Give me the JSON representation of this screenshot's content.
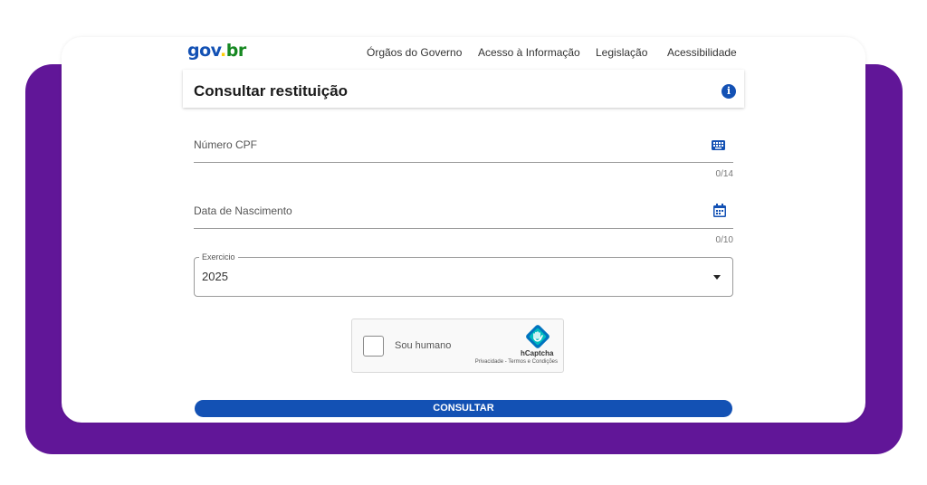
{
  "logo": {
    "part1": "gov",
    "dot": ".",
    "part2": "br"
  },
  "nav": {
    "items": [
      "Órgãos do Governo",
      "Acesso à Informação",
      "Legislação",
      "Acessibilidade"
    ]
  },
  "header": {
    "title": "Consultar restituição",
    "info_icon": "info-icon"
  },
  "form": {
    "cpf": {
      "label": "Número CPF",
      "counter": "0/14",
      "icon": "keyboard-icon"
    },
    "birth": {
      "label": "Data de Nascimento",
      "counter": "0/10",
      "icon": "calendar-icon"
    },
    "exercicio": {
      "label": "Exercicio",
      "value": "2025"
    }
  },
  "captcha": {
    "label": "Sou humano",
    "brand": "hCaptcha",
    "links": "Privacidade - Termos e Condições"
  },
  "submit": {
    "label": "CONSULTAR"
  },
  "colors": {
    "purple": "#611698",
    "primary": "#1351b4",
    "yellow": "#ffcd07",
    "green": "#168821"
  }
}
